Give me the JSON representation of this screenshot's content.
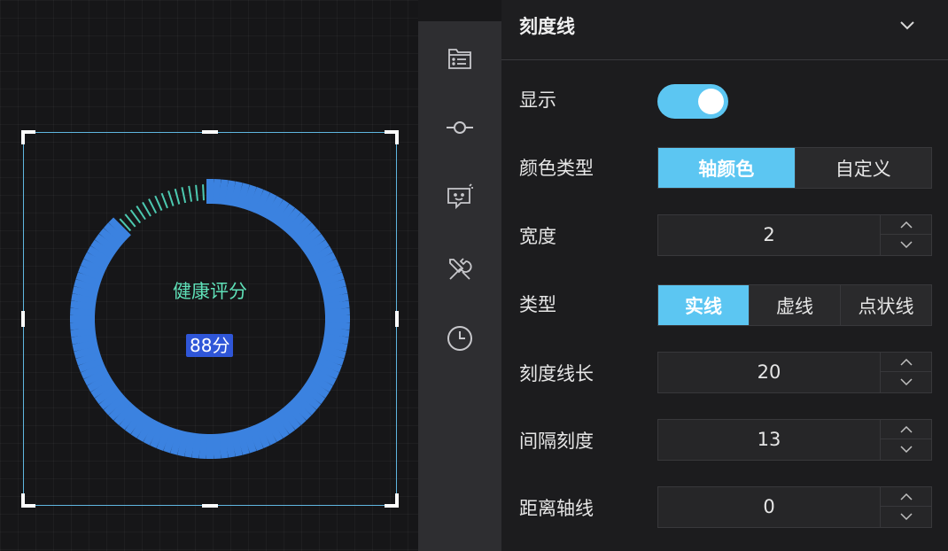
{
  "gauge": {
    "title": "健康评分",
    "value_label": "88分",
    "score": 88,
    "progress_color": "#3b82e0",
    "tick_color": "#4cc9b0"
  },
  "rail": {
    "icons": [
      "list-panel-icon",
      "connector-icon",
      "chat-bot-icon",
      "tools-icon",
      "clock-icon"
    ]
  },
  "panel": {
    "title": "刻度线",
    "rows": {
      "show": {
        "label": "显示",
        "on": true
      },
      "color_type": {
        "label": "颜色类型",
        "options": [
          "轴颜色",
          "自定义"
        ],
        "selected": 0
      },
      "width": {
        "label": "宽度",
        "value": "2"
      },
      "line_type": {
        "label": "类型",
        "options": [
          "实线",
          "虚线",
          "点状线"
        ],
        "selected": 0
      },
      "tick_length": {
        "label": "刻度线长",
        "value": "20"
      },
      "interval": {
        "label": "间隔刻度",
        "value": "13"
      },
      "distance": {
        "label": "距离轴线",
        "value": "0"
      }
    }
  },
  "colors": {
    "accent": "#5cc6f2",
    "selection_border": "#5fb6e0",
    "value_badge": "#2f56d8"
  }
}
